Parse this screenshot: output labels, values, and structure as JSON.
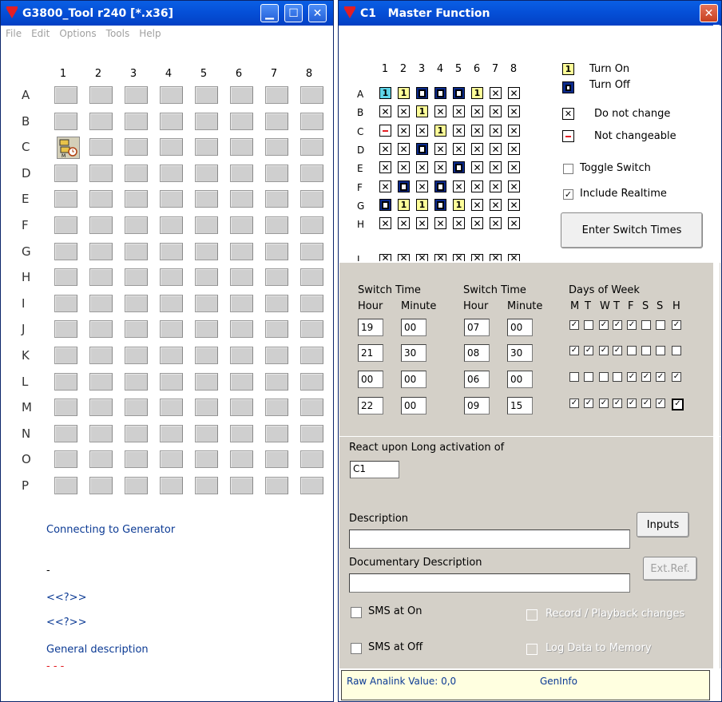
{
  "left": {
    "title": "G3800_Tool r240 [*.x36]",
    "menu": [
      "File",
      "Edit",
      "Options",
      "Tools",
      "Help"
    ],
    "columns": [
      "1",
      "2",
      "3",
      "4",
      "5",
      "6",
      "7",
      "8"
    ],
    "rows": [
      "A",
      "B",
      "C",
      "D",
      "E",
      "F",
      "G",
      "H",
      "I",
      "J",
      "K",
      "L",
      "M",
      "N",
      "O",
      "P"
    ],
    "status1": "Connecting to Generator",
    "status2": "-",
    "status3": "<<?>>",
    "status4": "<<?>>",
    "status5": "General description",
    "status6": "- - -"
  },
  "right": {
    "title": "C1   Master Function",
    "columns": [
      "1",
      "2",
      "3",
      "4",
      "5",
      "6",
      "7",
      "8"
    ],
    "rows": [
      "A",
      "B",
      "C",
      "D",
      "E",
      "F",
      "G",
      "H"
    ],
    "matrix": [
      [
        "on1",
        "on",
        "off",
        "off",
        "off",
        "on",
        "x",
        "x"
      ],
      [
        "x",
        "x",
        "on",
        "x",
        "x",
        "x",
        "x",
        "x"
      ],
      [
        "nc",
        "x",
        "x",
        "on",
        "x",
        "x",
        "x",
        "x"
      ],
      [
        "x",
        "x",
        "off",
        "x",
        "x",
        "x",
        "x",
        "x"
      ],
      [
        "x",
        "x",
        "x",
        "x",
        "off",
        "x",
        "x",
        "x"
      ],
      [
        "x",
        "off",
        "x",
        "off",
        "x",
        "x",
        "x",
        "x"
      ],
      [
        "off",
        "on",
        "on",
        "off",
        "on",
        "x",
        "x",
        "x"
      ],
      [
        "x",
        "x",
        "x",
        "x",
        "x",
        "x",
        "x",
        "x"
      ]
    ],
    "legend": {
      "turn_on": "Turn On",
      "turn_off": "Turn Off",
      "do_not_change": "Do not change",
      "not_changeable": "Not changeable"
    },
    "toggle_switch": "Toggle Switch",
    "include_realtime": "Include Realtime",
    "include_realtime_checked": true,
    "enter_switch_times": "Enter Switch Times",
    "switch_time": "Switch Time",
    "hour": "Hour",
    "minute": "Minute",
    "days_of_week": "Days of Week",
    "days": [
      "M",
      "T",
      "W",
      "T",
      "F",
      "S",
      "S",
      "H"
    ],
    "times": [
      {
        "h1": "19",
        "m1": "00",
        "h2": "07",
        "m2": "00",
        "days": [
          1,
          0,
          1,
          1,
          1,
          0,
          0,
          1
        ]
      },
      {
        "h1": "21",
        "m1": "30",
        "h2": "08",
        "m2": "30",
        "days": [
          1,
          1,
          1,
          1,
          0,
          0,
          0,
          0
        ]
      },
      {
        "h1": "00",
        "m1": "00",
        "h2": "06",
        "m2": "00",
        "days": [
          0,
          0,
          0,
          0,
          1,
          1,
          1,
          1
        ]
      },
      {
        "h1": "22",
        "m1": "00",
        "h2": "09",
        "m2": "15",
        "days": [
          1,
          1,
          1,
          1,
          1,
          1,
          1,
          1
        ]
      }
    ],
    "react_label": "React upon Long activation of",
    "react_value": "C1",
    "description": "Description",
    "doc_description": "Documentary Description",
    "inputs_btn": "Inputs",
    "extref_btn": "Ext.Ref.",
    "sms_on": "SMS at On",
    "sms_off": "SMS at Off",
    "record_playback": "Record / Playback changes",
    "log_data": "Log Data to Memory",
    "raw_analink": "Raw Analink Value: 0,0",
    "geninfo": "GenInfo"
  }
}
